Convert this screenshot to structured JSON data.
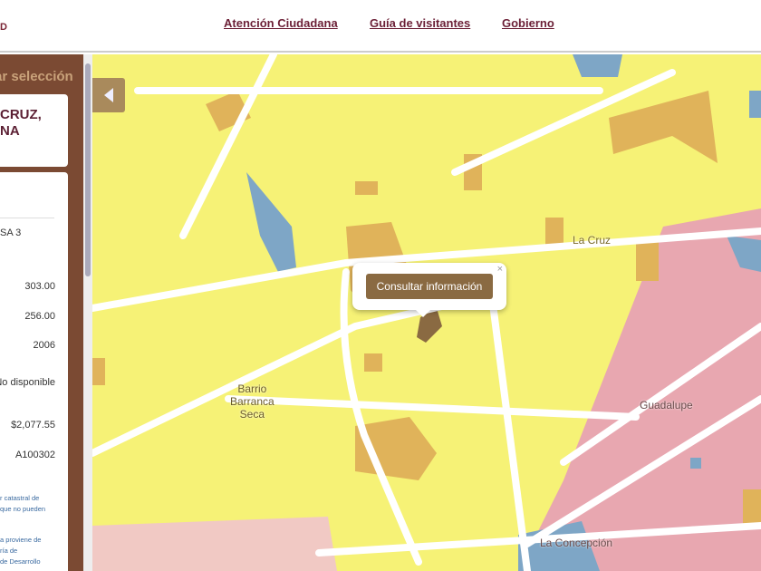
{
  "header": {
    "logo_fragment": "D",
    "nav": [
      "Atención Ciudadana",
      "Guía de visitantes",
      "Gobierno"
    ]
  },
  "sidebar": {
    "clear_selection": "ar selección",
    "title_line1": "CRUZ,",
    "title_line2": "NA",
    "field_fragment": "SA 3",
    "values": [
      "303.00",
      "256.00",
      "2006",
      "No disponible",
      "$2,077.55",
      "A100302"
    ],
    "note1": [
      "r catastral de",
      "que no pueden"
    ],
    "note2": [
      "a proviene de",
      "ría de",
      "de Desarrollo"
    ]
  },
  "map": {
    "popup_button": "Consultar información",
    "popup_close": "×",
    "labels": {
      "la_cruz": "La Cruz",
      "barrio_line1": "Barrio",
      "barrio_line2": "Barranca",
      "barrio_line3": "Seca",
      "guadalupe": "Guadalupe",
      "la_concepcion": "La Concepción"
    },
    "colors": {
      "base": "#f6f276",
      "block": "#e0b35a",
      "water": "#7ea6c6",
      "urban": "#e8a7b0",
      "selected": "#8a6a42"
    }
  }
}
